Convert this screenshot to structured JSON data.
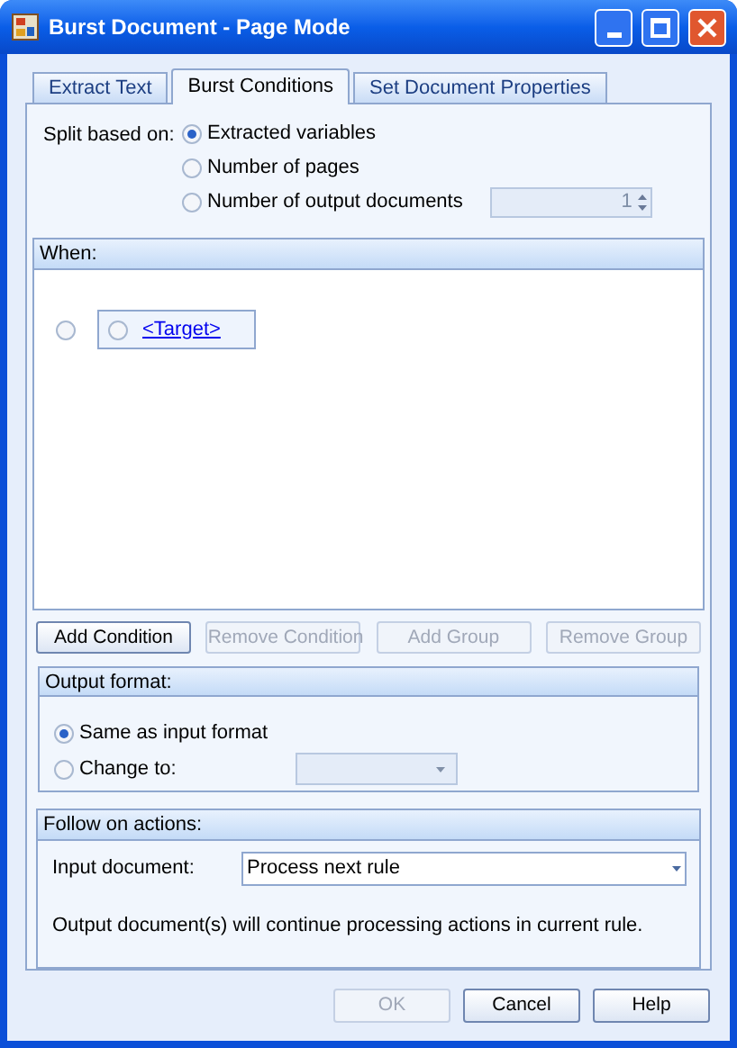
{
  "window": {
    "title": "Burst Document - Page Mode"
  },
  "tabs": [
    {
      "label": "Extract Text",
      "selected": false
    },
    {
      "label": "Burst Conditions",
      "selected": true
    },
    {
      "label": "Set Document Properties",
      "selected": false
    }
  ],
  "split": {
    "label": "Split based on:",
    "options": [
      {
        "label": "Extracted variables",
        "selected": true
      },
      {
        "label": "Number of pages",
        "selected": false
      },
      {
        "label": "Number of output documents",
        "selected": false
      }
    ],
    "spinner": {
      "value": "1",
      "disabled": true
    }
  },
  "when": {
    "title": "When:",
    "group_radio": {
      "selected": false
    },
    "condition_radio": {
      "selected": false
    },
    "target": "<Target>"
  },
  "condition_buttons": [
    {
      "label": "Add Condition",
      "disabled": false
    },
    {
      "label": "Remove Condition",
      "disabled": true
    },
    {
      "label": "Add Group",
      "disabled": true
    },
    {
      "label": "Remove Group",
      "disabled": true
    }
  ],
  "output_format": {
    "title": "Output format:",
    "options": [
      {
        "label": "Same as input format",
        "selected": true
      },
      {
        "label": "Change to:",
        "selected": false
      }
    ],
    "dropdown": {
      "disabled": true
    }
  },
  "follow_on": {
    "title": "Follow on actions:",
    "label": "Input document:",
    "dropdown": {
      "value": "Process next rule"
    },
    "note": "Output document(s) will continue processing actions in current rule."
  },
  "dialog_buttons": [
    {
      "label": "OK",
      "disabled": true
    },
    {
      "label": "Cancel",
      "disabled": false
    },
    {
      "label": "Help",
      "disabled": false
    }
  ]
}
